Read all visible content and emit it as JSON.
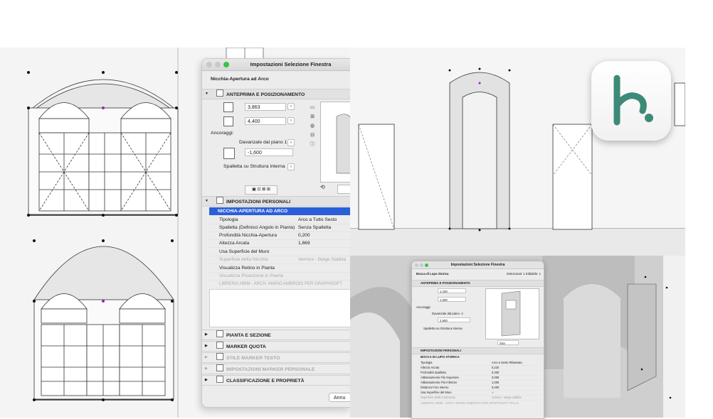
{
  "colors": {
    "accent": "#2b5fd9",
    "logo_green": "#3c8a77",
    "marker_purple": "#a020c0"
  },
  "dialog": {
    "title": "Impostazioni Selezione Finestra",
    "object_name": "Nicchia-Apertura ad Arco",
    "sections": {
      "preview": "ANTEPRIMA E POSIZIONAMENTO",
      "personal": "IMPOSTAZIONI PERSONALI",
      "plan": "PIANTA E SEZIONE",
      "marker_quota": "MARKER QUOTA",
      "marker_testo": "STILE MARKER TESTO",
      "marker_personale": "IMPOSTAZIONI MARKER PERSONALE",
      "classification": "CLASSIFICAZIONE E PROPRIETÀ"
    },
    "width_value": "3,863",
    "height_value": "4,400",
    "anchors_label": "Ancoraggi:",
    "sill_select": "Davanzale dal piano 1",
    "sill_value": "-1,600",
    "reveal_select": "Spalletta su Struttura Interna",
    "selected_param": "NICCHIA-APERTURA AD ARCO",
    "params": [
      {
        "key": "Tipologia",
        "value": "Arco a Tutto Sesto"
      },
      {
        "key": "Spalletta (Definisci Angolo in Pianta)",
        "value": "Senza Spalletta"
      },
      {
        "key": "Profondità Nicchia-Apertura",
        "value": "0,200"
      },
      {
        "key": "Altezza Arcata",
        "value": "1,669"
      },
      {
        "key": "Usa Superficie del Muro",
        "value": ""
      },
      {
        "key": "Superficie della Nicchia",
        "value": "Vernice - Beige Sabbia"
      },
      {
        "key": "Visualizza Retino in Pianta",
        "value": ""
      },
      {
        "key": "Visualizza Proiezione in Pianta",
        "value": ""
      }
    ],
    "library_note": "LIBRERIA HBIM - ARCH. MARIO AMBROGI PER GRAPHISOFT",
    "cancel_label": "Annu"
  },
  "dialog2": {
    "title": "Impostazioni Selezione Finestra",
    "object_name": "Bocca di Lupo Storica",
    "selection_info": "Selezionati: 1 Editabile: 1",
    "preview_section": "ANTEPRIMA E POSIZIONAMENTO",
    "width_value": "1,100",
    "height_value": "1,000",
    "anchors_label": "Ancoraggi:",
    "sill_select": "Davanzale dal piano -1",
    "sill_value": "2,600",
    "reveal_select": "Spalletta su Struttura Interna",
    "side_select": "Sira",
    "personal_section": "IMPOSTAZIONI PERSONALI",
    "selected_param": "BOCCA DI LUPO STORICA",
    "params": [
      {
        "key": "Tipologia",
        "value": "Arco a Sesto Ribassato"
      },
      {
        "key": "Altezza Arcata",
        "value": "0,220"
      },
      {
        "key": "Profondità Spalletta",
        "value": "0,300"
      },
      {
        "key": "Abbassamento Filo Superiore",
        "value": "0,000"
      },
      {
        "key": "Abbassamento Filo Inferiore",
        "value": "1,000"
      },
      {
        "key": "Distanza Foro Interno",
        "value": "0,400"
      },
      {
        "key": "Usa Superficie del Muro",
        "value": "✓"
      },
      {
        "key": "Superficie della Foronomia",
        "value": "Vernice - Beige Sabbia"
      }
    ],
    "library_note": "LIBRERIA HBIM - ARCH. MARIO AMBROGI PER GRAPHISOFT ITALIA"
  }
}
